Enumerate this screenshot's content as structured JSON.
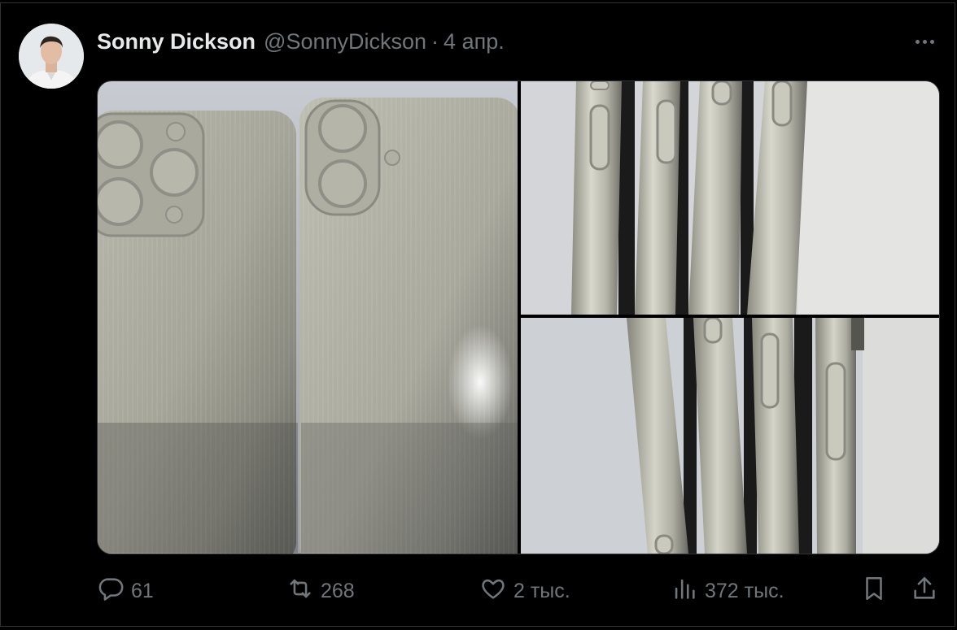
{
  "tweet": {
    "author_name": "Sonny Dickson",
    "author_handle": "@SonnyDickson",
    "separator": "·",
    "date": "4 апр.",
    "more_icon": "more-horizontal-icon"
  },
  "media": {
    "images": [
      "phone-backs-photo",
      "phone-sides-top-photo",
      "phone-sides-bottom-photo"
    ]
  },
  "actions": {
    "replies": "61",
    "reposts": "268",
    "likes": "2 тыс.",
    "views": "372 тыс.",
    "icons": [
      "reply-icon",
      "repost-icon",
      "like-icon",
      "views-icon",
      "bookmark-icon",
      "share-icon"
    ]
  },
  "colors": {
    "background": "#000000",
    "text": "#e7e9ea",
    "secondary": "#71767b",
    "border": "#2f3336"
  }
}
